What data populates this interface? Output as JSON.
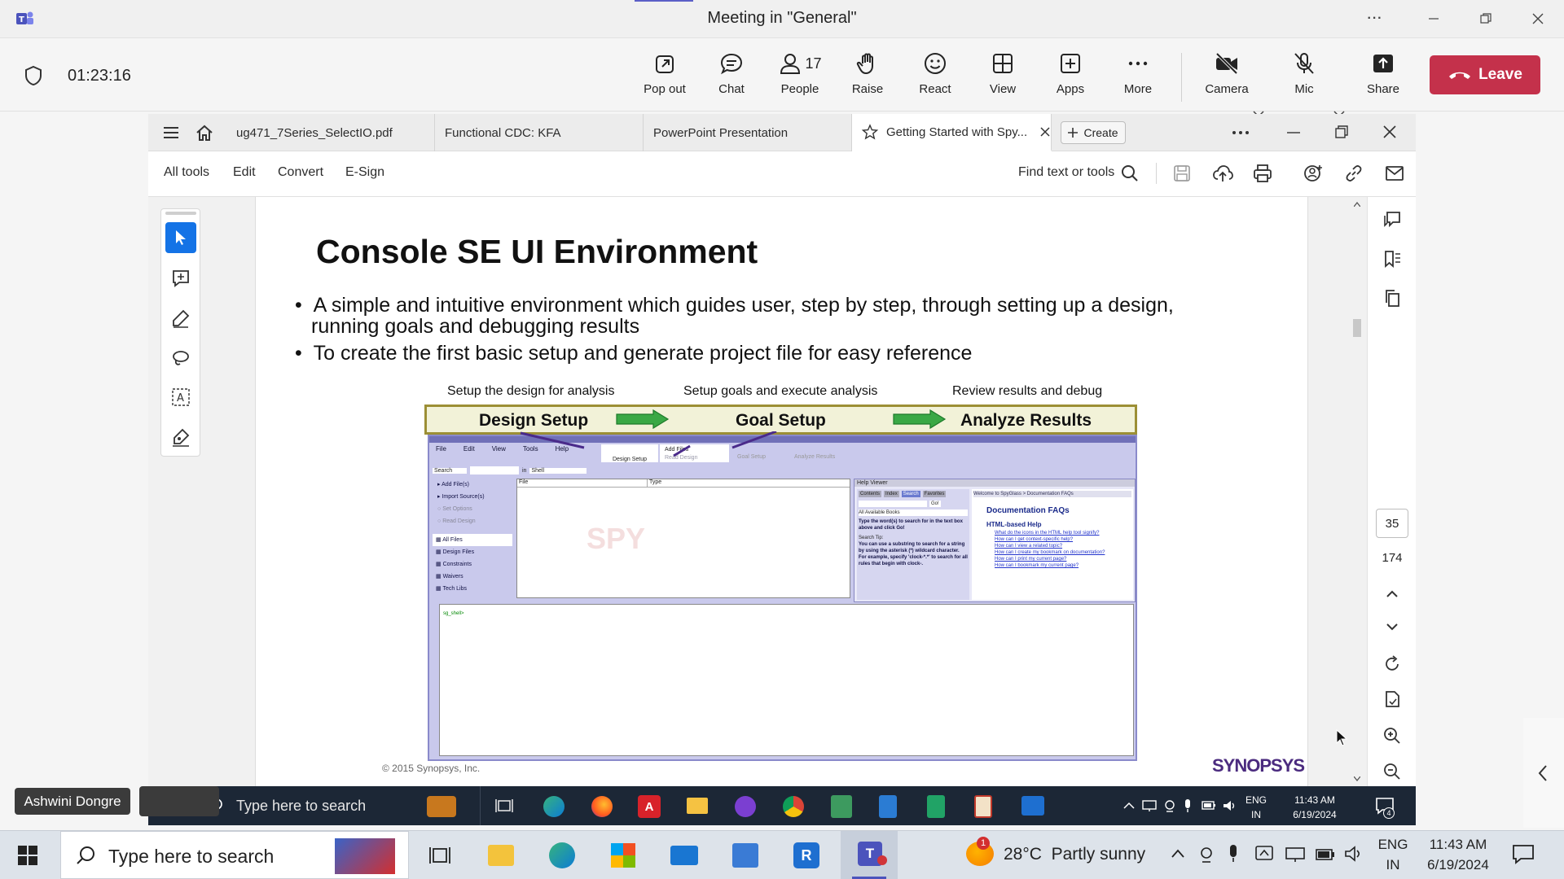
{
  "teams": {
    "window_title": "Meeting in \"General\"",
    "more_label": "···",
    "timer": "01:23:16",
    "toolbar": [
      {
        "id": "pop-out",
        "label": "Pop out",
        "icon": "pop-out-icon"
      },
      {
        "id": "chat",
        "label": "Chat",
        "icon": "chat-icon"
      },
      {
        "id": "people",
        "label": "People",
        "icon": "people-icon",
        "count": "17"
      },
      {
        "id": "raise",
        "label": "Raise",
        "icon": "raise-hand-icon"
      },
      {
        "id": "react",
        "label": "React",
        "icon": "smiley-icon"
      },
      {
        "id": "view",
        "label": "View",
        "icon": "grid-icon"
      },
      {
        "id": "apps",
        "label": "Apps",
        "icon": "plus-square-icon"
      },
      {
        "id": "more",
        "label": "More",
        "icon": "ellipsis-icon"
      }
    ],
    "camera_label": "Camera",
    "mic_label": "Mic",
    "share_label": "Share",
    "leave_label": "Leave",
    "participant_name": "Ashwini Dongre",
    "leave_color": "#c4314b"
  },
  "acrobat": {
    "tabs": [
      {
        "label": "ug471_7Series_SelectIO.pdf"
      },
      {
        "label": "Functional CDC: KFA"
      },
      {
        "label": "PowerPoint Presentation"
      },
      {
        "label": "Getting Started with Spy...",
        "active": true
      }
    ],
    "create_label": "Create",
    "menu": [
      "All tools",
      "Edit",
      "Convert",
      "E-Sign"
    ],
    "find_label": "Find text or tools",
    "page_number": "35",
    "page_total": "174"
  },
  "slide": {
    "title": "Console SE UI Environment",
    "bullets": [
      "A simple and intuitive environment which guides user, step by step, through setting up a design,",
      "running goals and debugging results",
      "To create the first basic setup and generate project file for easy reference"
    ],
    "step_captions": [
      "Setup the design for analysis",
      "Setup goals and execute analysis",
      "Review results and debug"
    ],
    "steps": [
      "Design Setup",
      "Goal Setup",
      "Analyze Results"
    ],
    "mock_menu": [
      "File",
      "Edit",
      "View",
      "Tools",
      "Help"
    ],
    "mock_tabs": [
      "Design Setup",
      "Add Files",
      "Read Design",
      "Goal Setup",
      "Analyze Results"
    ],
    "mock_search": "Search",
    "mock_in": "in",
    "mock_shell": "Shell",
    "mock_left": [
      "Add File(s)",
      "Import Source(s)",
      "Set Options",
      "Read Design"
    ],
    "mock_files": [
      "All Files",
      "Design Files",
      "Constraints",
      "Waivers",
      "Tech Libs"
    ],
    "mock_cols": [
      "File",
      "Type"
    ],
    "help_viewer": "Help Viewer",
    "help_tabs": [
      "Contents",
      "Index",
      "Search",
      "Favorites"
    ],
    "help_go": "Go!",
    "help_books": "All Available Books",
    "help_text": "Type the word(s) to search for in the text box above and click Go!",
    "search_tip": "Search Tip:",
    "search_tip_text": "You can use a substring to search for a string by using the asterisk (*) wildcard character. For example, specify 'clock-*.*' to search for all rules that begin with clock-.",
    "help_breadcrumb": "Welcome to SpyGlass > Documentation FAQs",
    "doc_faq": "Documentation FAQs",
    "html_help": "HTML-based Help",
    "help_links": [
      "What do the icons in the HTML help tool signify?",
      "How can I get context-specific help?",
      "How can I view a related topic?",
      "How can I create my bookmark on documentation?",
      "How can I print my current page?",
      "How can I bookmark my current page?"
    ],
    "console_prompt": "sg_shell>",
    "watermark": "SPY",
    "copyright": "© 2015 Synopsys, Inc.",
    "logo": "SYNOPSYS"
  },
  "inner_taskbar": {
    "search_placeholder": "Type here to search",
    "lang_top": "ENG",
    "lang_bottom": "IN",
    "time": "11:43 AM",
    "date": "6/19/2024",
    "notif_count": "4"
  },
  "taskbar": {
    "search_placeholder": "Type here to search",
    "weather": "28°C  Partly sunny",
    "weather_badge": "1",
    "lang_top": "ENG",
    "lang_bottom": "IN",
    "time": "11:43 AM",
    "date": "6/19/2024"
  },
  "colors": {
    "teams_accent": "#5b5fc7",
    "leave": "#c4314b",
    "step_bar": "#f2f2d8",
    "step_arrow": "#3aa845",
    "ui_bg": "#c9c9ec"
  }
}
